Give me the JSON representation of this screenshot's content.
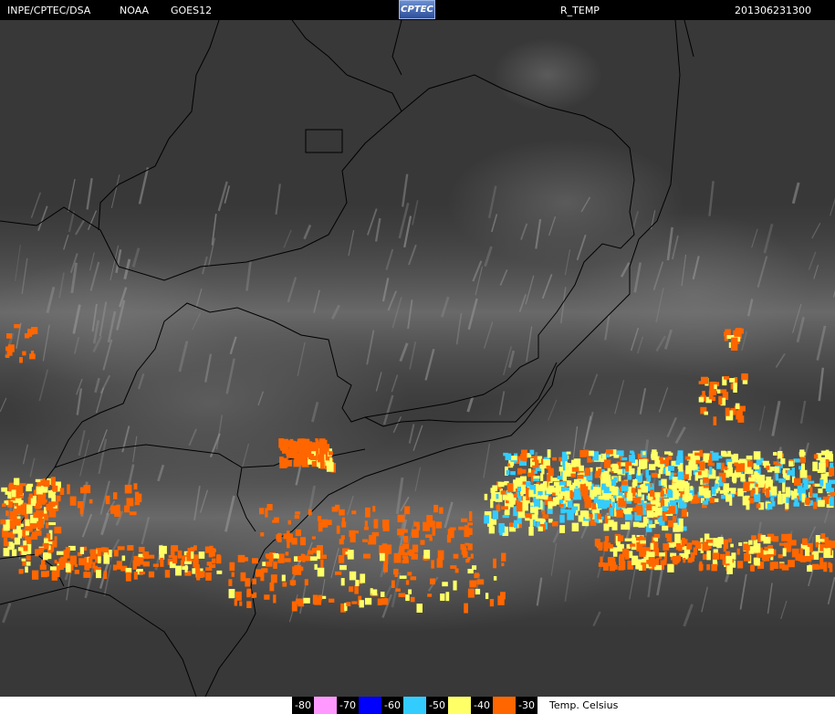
{
  "header": {
    "source": "INPE/CPTEC/DSA",
    "agency": "NOAA",
    "satellite": "GOES12",
    "logo_text": "CPTEC",
    "product": "R_TEMP",
    "timestamp": "201306231300"
  },
  "legend": {
    "items": [
      {
        "label": "-80",
        "color": "#ff99ff"
      },
      {
        "label": "-70",
        "color": "#0000ff"
      },
      {
        "label": "-60",
        "color": "#33ccff"
      },
      {
        "label": "-50",
        "color": "#ffff66"
      },
      {
        "label": "-40",
        "color": "#ff6600"
      },
      {
        "label": "-30",
        "color": "#ffffff"
      }
    ],
    "unit": "Temp. Celsius"
  },
  "colors": {
    "cold_orange": "#ff6600",
    "cold_yellow": "#ffff66",
    "cold_cyan": "#33ccff",
    "background_gray": "#3a3a3a"
  }
}
